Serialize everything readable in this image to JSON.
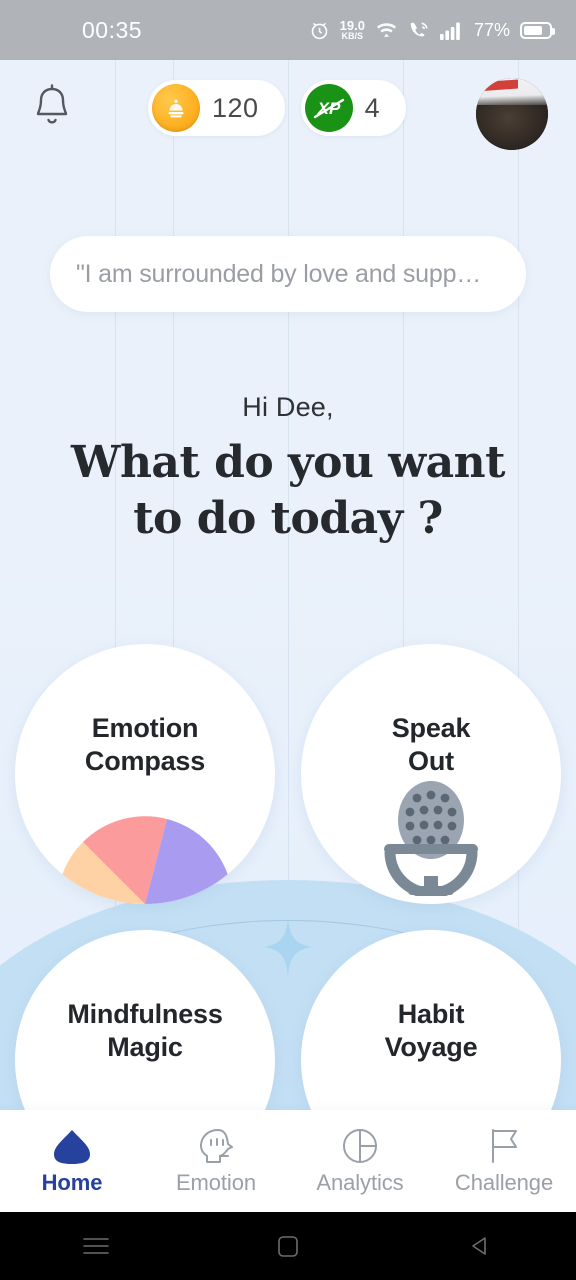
{
  "statusbar": {
    "time": "00:35",
    "alarm_icon": "alarm-icon",
    "net_speed_value": "19.0",
    "net_speed_unit": "KB/S",
    "wifi_icon": "wifi-icon",
    "call_icon": "call-wifi-icon",
    "signal_icon": "cellular-signal-icon",
    "battery_percent": "77%",
    "battery_icon": "battery-icon",
    "bg_color": "#b0b4b8"
  },
  "header": {
    "bell_icon": "bell-icon",
    "coin": {
      "icon": "coin-icon",
      "value": "120",
      "color": "#ffb224"
    },
    "xp": {
      "icon": "xp-icon",
      "label": "XP",
      "value": "4",
      "color": "#1a9216"
    },
    "avatar": "user-avatar"
  },
  "quote": {
    "text": "\"I am surrounded by love and supp…"
  },
  "greeting": {
    "hello": "Hi Dee,",
    "headline_line1": "What do you want",
    "headline_line2": "to do today ?"
  },
  "cards": [
    {
      "id": "emotion-compass",
      "title_line1": "Emotion",
      "title_line2": "Compass",
      "art": "pie-chart-art",
      "segments": [
        {
          "name": "peach",
          "color": "#ffd2a6"
        },
        {
          "name": "salmon",
          "color": "#fc9b9b"
        },
        {
          "name": "purple",
          "color": "#a99cf0"
        },
        {
          "name": "cyan",
          "color": "#b6e9f5"
        },
        {
          "name": "green",
          "color": "#b8f5a8"
        }
      ]
    },
    {
      "id": "speak-out",
      "title_line1": "Speak",
      "title_line2": "Out",
      "art": "microphone-art",
      "color": "#7b8896"
    },
    {
      "id": "mindfulness-magic",
      "title_line1": "Mindfulness",
      "title_line2": "Magic",
      "art": "mint-leaf-art",
      "color": "#a8e4cd"
    },
    {
      "id": "habit-voyage",
      "title_line1": "Habit",
      "title_line2": "Voyage",
      "art": "paper-boat-art",
      "color": "#f6dca0"
    }
  ],
  "bottom_nav": {
    "active": "Home",
    "items": [
      {
        "label": "Home",
        "icon": "home-icon",
        "active": true
      },
      {
        "label": "Emotion",
        "icon": "head-profile-icon",
        "active": false
      },
      {
        "label": "Analytics",
        "icon": "pie-circle-icon",
        "active": false
      },
      {
        "label": "Challenge",
        "icon": "flag-icon",
        "active": false
      }
    ],
    "active_color": "#26429c",
    "inactive_color": "#9aa0a8"
  },
  "android_nav": {
    "recents": "recents-icon",
    "home": "android-home-icon",
    "back": "back-icon"
  },
  "theme": {
    "background_top": "#eaf1fa",
    "hill_color": "#c3dff4",
    "card_bg": "#ffffff",
    "text_dark": "#23262a"
  }
}
